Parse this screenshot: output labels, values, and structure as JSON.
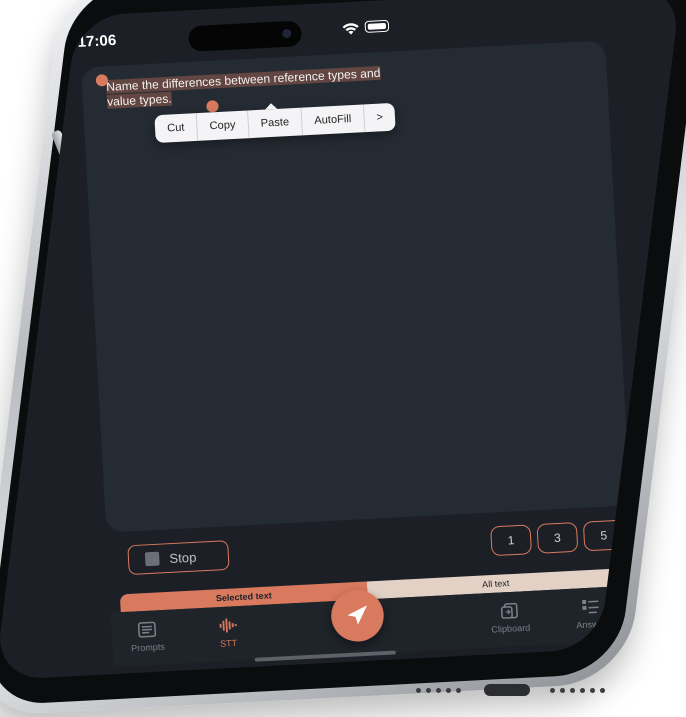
{
  "status_bar": {
    "time": "17:06"
  },
  "editor": {
    "prompt_text": "Name the differences between reference types and value types."
  },
  "context_menu": {
    "items": [
      "Cut",
      "Copy",
      "Paste",
      "AutoFill",
      ">"
    ]
  },
  "controls": {
    "stop_label": "Stop",
    "number_buttons": [
      "1",
      "3",
      "5"
    ]
  },
  "mode_toggle": {
    "selected_text": "Selected text",
    "all_text": "All text"
  },
  "tab_bar": {
    "prompts": "Prompts",
    "stt": "STT",
    "clipboard": "Clipboard",
    "answer": "Answer"
  },
  "colors": {
    "accent": "#d97a5e",
    "screen_background": "#1c2026",
    "panel_background": "#252b33"
  }
}
